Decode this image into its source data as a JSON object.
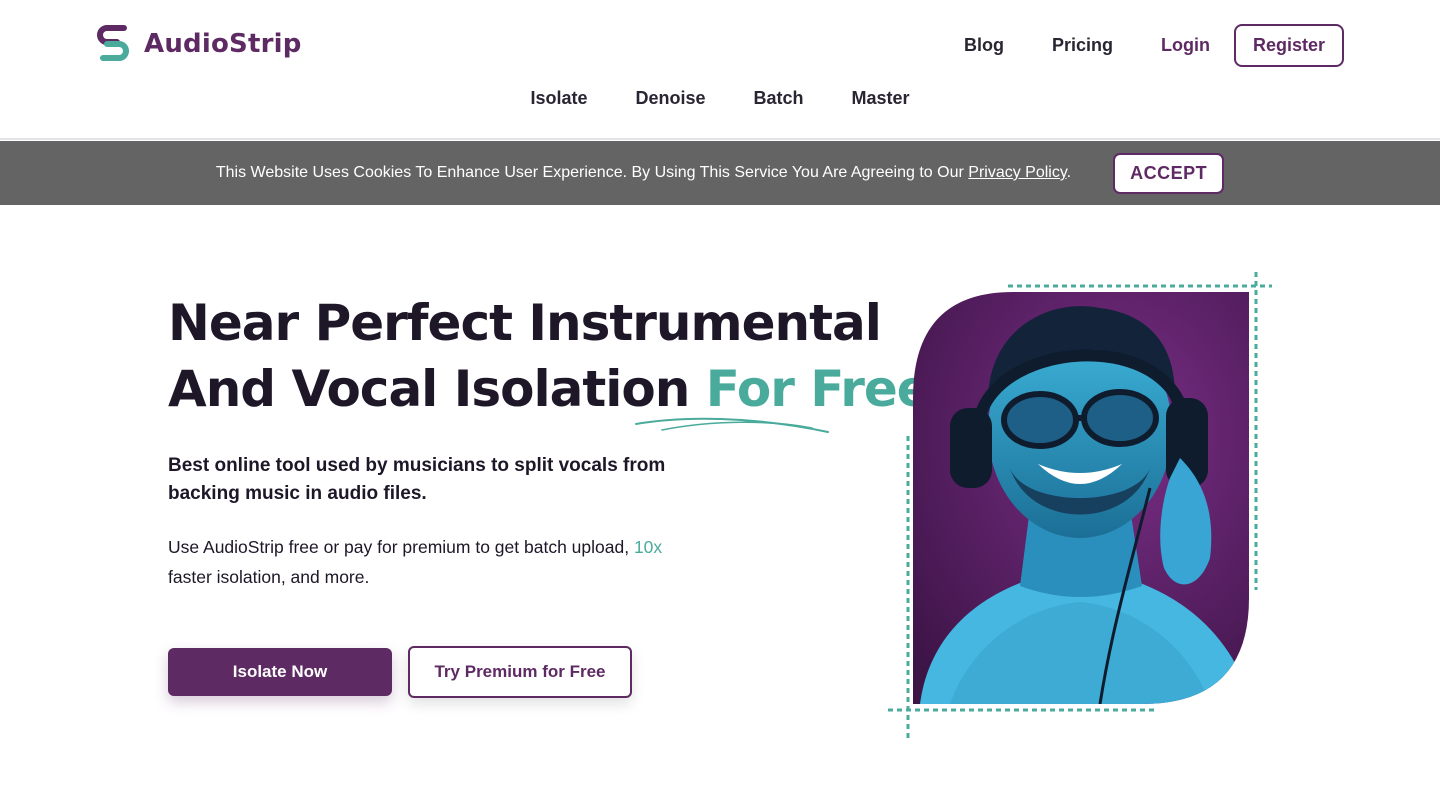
{
  "brand": {
    "name": "AudioStrip",
    "colors": {
      "primary": "#5e2a63",
      "accent": "#4aab9c",
      "banner": "#646464"
    }
  },
  "top_nav": {
    "blog": "Blog",
    "pricing": "Pricing",
    "login": "Login",
    "register": "Register"
  },
  "sub_nav": [
    "Isolate",
    "Denoise",
    "Batch",
    "Master"
  ],
  "cookie": {
    "text": "This Website Uses Cookies To Enhance User Experience. By Using This Service You Are Agreeing to Our ",
    "link": "Privacy Policy",
    "suffix": ".",
    "accept": "ACCEPT"
  },
  "hero": {
    "line1": "Near Perfect Instrumental",
    "line2": "And Vocal Isolation ",
    "accent": "For Free!",
    "subtitle": "Best online tool used by musicians to split vocals from backing music in audio files.",
    "desc_before": "Use AudioStrip free or pay for premium to get batch upload, ",
    "desc_accent": "10x",
    "desc_after": " faster isolation, and more.",
    "primary_button": "Isolate Now",
    "secondary_button": "Try Premium for Free"
  }
}
